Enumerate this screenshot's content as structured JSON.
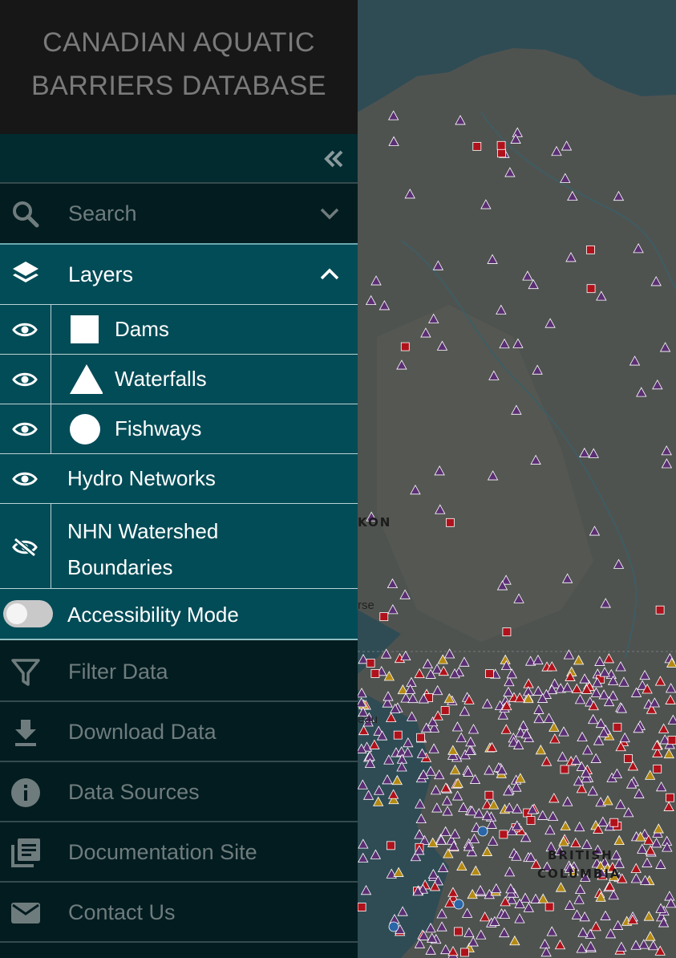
{
  "app": {
    "title_line1": "CANADIAN AQUATIC",
    "title_line2": "BARRIERS DATABASE"
  },
  "sidebar": {
    "collapse_icon": "double-chevron-left-icon",
    "search": {
      "label": "Search",
      "icon": "search-icon",
      "state": "collapsed"
    },
    "layers": {
      "label": "Layers",
      "icon": "layers-icon",
      "state": "expanded",
      "items": [
        {
          "label": "Dams",
          "symbol": "square",
          "visible": true
        },
        {
          "label": "Waterfalls",
          "symbol": "triangle",
          "visible": true
        },
        {
          "label": "Fishways",
          "symbol": "circle",
          "visible": true
        },
        {
          "label": "Hydro Networks",
          "visible": true
        },
        {
          "label": "NHN Watershed Boundaries",
          "visible": false
        }
      ],
      "accessibility_mode": {
        "label": "Accessibility Mode",
        "enabled": false
      }
    },
    "menu": [
      {
        "label": "Filter Data",
        "icon": "filter-icon"
      },
      {
        "label": "Download Data",
        "icon": "download-icon"
      },
      {
        "label": "Data Sources",
        "icon": "info-icon"
      },
      {
        "label": "Documentation Site",
        "icon": "documentation-icon"
      },
      {
        "label": "Contact Us",
        "icon": "mail-icon"
      }
    ]
  },
  "map": {
    "labels": {
      "yukon": "KON",
      "whitehorse": "rse",
      "juneau": "eau",
      "bc_line1": "BRITISH",
      "bc_line2": "COLUMBIA"
    },
    "colors": {
      "water": "#2f4e57",
      "land": "#5a5d55",
      "waterfall_marker": "#5b2f73",
      "dam_marker": "#b0121b",
      "fishway_marker": "#2a66a8",
      "yellow_marker": "#b58a12"
    }
  }
}
